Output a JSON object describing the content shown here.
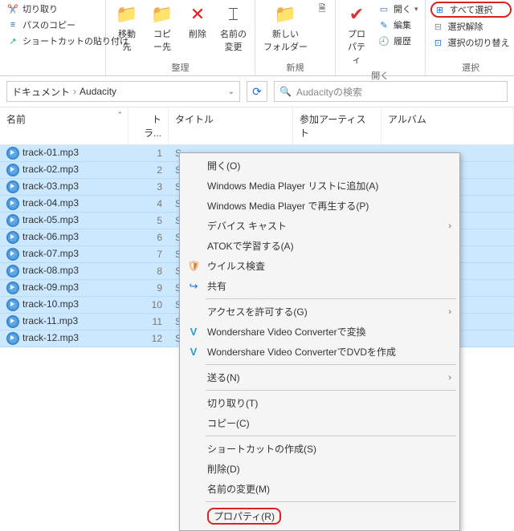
{
  "ribbon": {
    "clipboard": {
      "cut": "切り取り",
      "copy_path": "パスのコピー",
      "paste_shortcut": "ショートカットの貼り付け"
    },
    "organize": {
      "label": "整理",
      "move_to": "移動先",
      "copy_to": "コピー先",
      "delete": "削除",
      "rename": "名前の\n変更"
    },
    "new": {
      "label": "新規",
      "new_folder": "新しい\nフォルダー"
    },
    "open": {
      "label": "開く",
      "properties": "プロパティ",
      "open_btn": "開く",
      "edit": "編集",
      "history": "履歴"
    },
    "select": {
      "label": "選択",
      "select_all": "すべて選択",
      "select_none": "選択解除",
      "invert": "選択の切り替え"
    }
  },
  "address": {
    "crumb1": "ドキュメント",
    "crumb2": "Audacity",
    "search_placeholder": "Audacityの検索"
  },
  "columns": {
    "name": "名前",
    "track": "トラ...",
    "title": "タイトル",
    "artist": "参加アーティスト",
    "album": "アルバム"
  },
  "rows": [
    {
      "name": "track-01.mp3",
      "track": "1",
      "title": "S"
    },
    {
      "name": "track-02.mp3",
      "track": "2",
      "title": "S"
    },
    {
      "name": "track-03.mp3",
      "track": "3",
      "title": "S"
    },
    {
      "name": "track-04.mp3",
      "track": "4",
      "title": "S"
    },
    {
      "name": "track-05.mp3",
      "track": "5",
      "title": "S"
    },
    {
      "name": "track-06.mp3",
      "track": "6",
      "title": "S"
    },
    {
      "name": "track-07.mp3",
      "track": "7",
      "title": "S"
    },
    {
      "name": "track-08.mp3",
      "track": "8",
      "title": "S"
    },
    {
      "name": "track-09.mp3",
      "track": "9",
      "title": "S"
    },
    {
      "name": "track-10.mp3",
      "track": "10",
      "title": "S"
    },
    {
      "name": "track-11.mp3",
      "track": "11",
      "title": "S"
    },
    {
      "name": "track-12.mp3",
      "track": "12",
      "title": "S"
    }
  ],
  "ctx": {
    "open": "開く(O)",
    "wmp_add": "Windows Media Player リストに追加(A)",
    "wmp_play": "Windows Media Player で再生する(P)",
    "cast": "デバイス キャスト",
    "atok": "ATOKで学習する(A)",
    "virus": "ウイルス検査",
    "share": "共有",
    "access": "アクセスを許可する(G)",
    "ws_convert": "Wondershare Video Converterで変換",
    "ws_dvd": "Wondershare Video ConverterでDVDを作成",
    "send": "送る(N)",
    "cut": "切り取り(T)",
    "copy": "コピー(C)",
    "shortcut": "ショートカットの作成(S)",
    "delete": "削除(D)",
    "rename": "名前の変更(M)",
    "properties": "プロパティ(R)"
  }
}
